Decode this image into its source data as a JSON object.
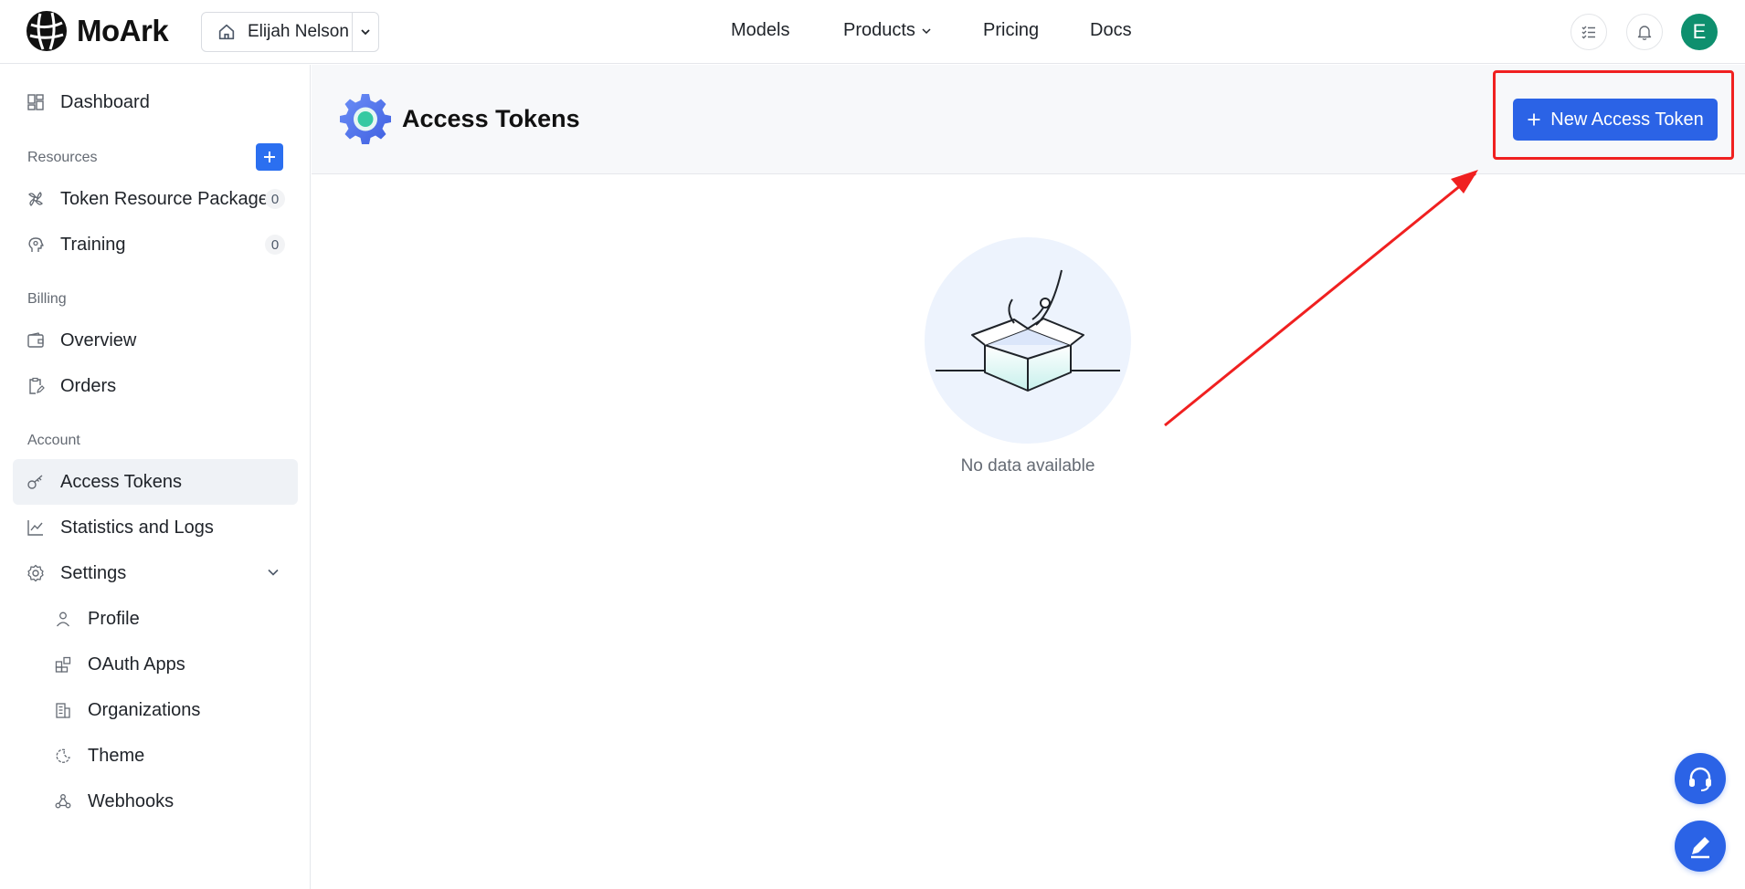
{
  "header": {
    "logo_text": "MoArk",
    "space_name": "Elijah Nelson",
    "nav": [
      {
        "label": "Models"
      },
      {
        "label": "Products"
      },
      {
        "label": "Pricing"
      },
      {
        "label": "Docs"
      }
    ],
    "avatar_letter": "E"
  },
  "sidebar": {
    "dashboard": "Dashboard",
    "sections": {
      "resources": "Resources",
      "billing": "Billing",
      "account": "Account"
    },
    "resources": [
      {
        "label": "Token Resource Package",
        "count": "0"
      },
      {
        "label": "Training",
        "count": "0"
      }
    ],
    "billing": [
      {
        "label": "Overview"
      },
      {
        "label": "Orders"
      }
    ],
    "account": [
      {
        "label": "Access Tokens"
      },
      {
        "label": "Statistics and Logs"
      },
      {
        "label": "Settings"
      }
    ],
    "settings_sub": [
      {
        "label": "Profile"
      },
      {
        "label": "OAuth Apps"
      },
      {
        "label": "Organizations"
      },
      {
        "label": "Theme"
      },
      {
        "label": "Webhooks"
      }
    ]
  },
  "main": {
    "title": "Access Tokens",
    "new_button": "New Access Token",
    "empty_text": "No data available"
  },
  "colors": {
    "accent": "#2b63e6",
    "avatar": "#0e8f6e",
    "annotation": "#f02020"
  }
}
